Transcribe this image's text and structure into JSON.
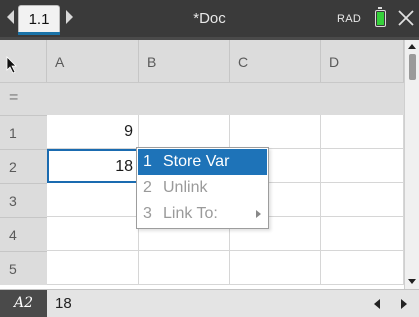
{
  "toolbar": {
    "page_tab": "1.1",
    "doc_title": "*Doc",
    "angle_mode": "RAD",
    "battery_color": "#35d13a"
  },
  "columns": [
    "A",
    "B",
    "C",
    "D"
  ],
  "formula_row_symbol": "=",
  "rows": [
    {
      "num": "1",
      "a": "9"
    },
    {
      "num": "2",
      "a": "18"
    },
    {
      "num": "3",
      "a": ""
    },
    {
      "num": "4",
      "a": ""
    },
    {
      "num": "5",
      "a": ""
    }
  ],
  "context_menu": {
    "items": [
      {
        "num": "1",
        "label": "Store Var",
        "state": "active"
      },
      {
        "num": "2",
        "label": "Unlink",
        "state": "disabled"
      },
      {
        "num": "3",
        "label": "Link To:",
        "state": "disabled",
        "has_submenu": true
      }
    ]
  },
  "entry_line": {
    "cell_ref": "A2",
    "value": "18"
  },
  "colors": {
    "selection": "#1e73b8",
    "header_bg": "#dcdcdc",
    "topbar_bg": "#3a3a3a"
  }
}
